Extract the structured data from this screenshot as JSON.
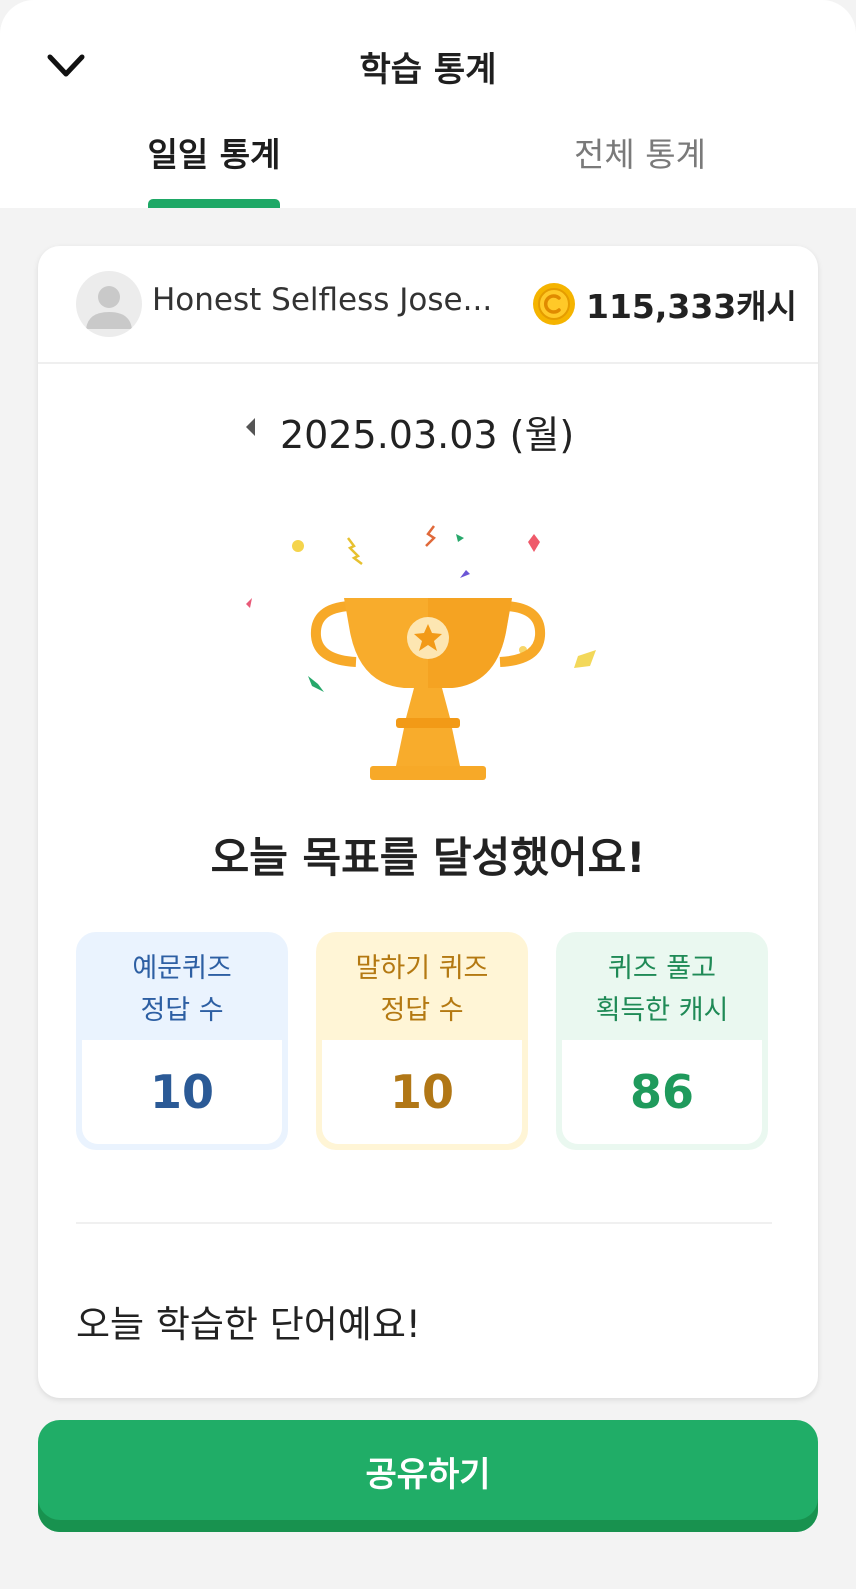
{
  "header": {
    "title": "학습 통계",
    "tabs": [
      {
        "label": "일일 통계",
        "active": true
      },
      {
        "label": "전체 통계",
        "active": false
      }
    ]
  },
  "profile": {
    "username": "Honest Selfless Jose...",
    "cash": "115,333캐시"
  },
  "date": {
    "label": "2025.03.03 (월)"
  },
  "achievement": "오늘 목표를 달성했어요!",
  "stats": [
    {
      "label_line1": "예문퀴즈",
      "label_line2": "정답 수",
      "value": "10"
    },
    {
      "label_line1": "말하기 퀴즈",
      "label_line2": "정답 수",
      "value": "10"
    },
    {
      "label_line1": "퀴즈 풀고",
      "label_line2": "획득한 캐시",
      "value": "86"
    }
  ],
  "words_title": "오늘 학습한 단어예요!",
  "share_label": "공유하기",
  "colors": {
    "accent": "#20ad67",
    "coin": "#f5b400",
    "trophy": "#f7a928"
  },
  "icons": [
    "chevron-down-icon",
    "avatar-placeholder",
    "coin-icon",
    "caret-left-icon",
    "trophy-illustration"
  ]
}
